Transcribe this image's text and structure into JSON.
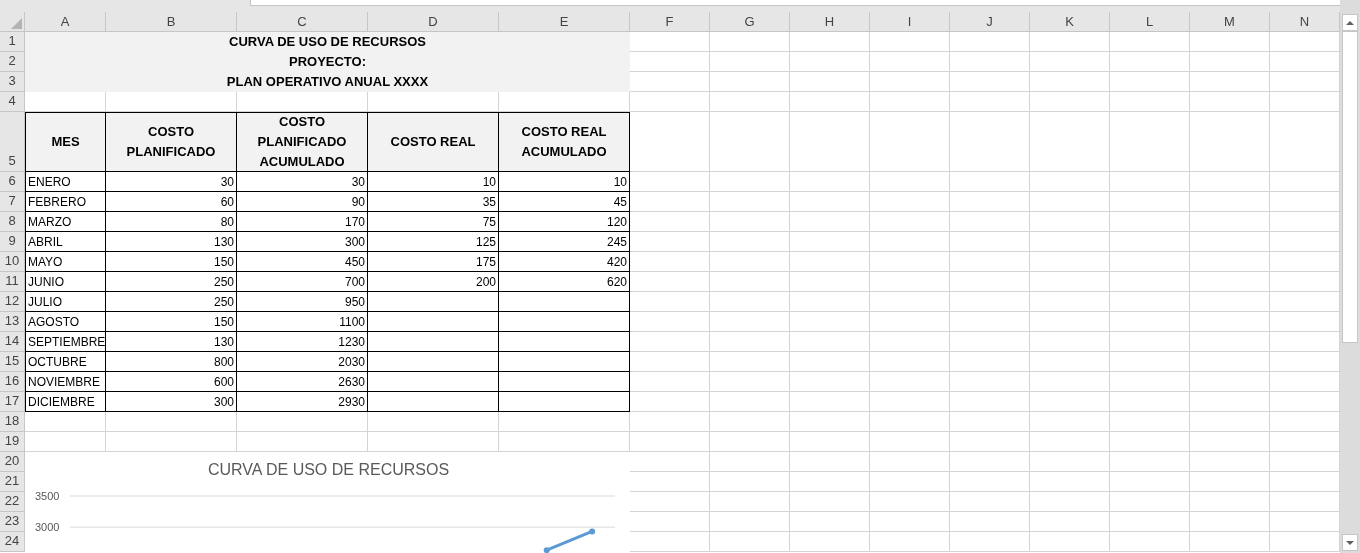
{
  "column_headers": [
    "A",
    "B",
    "C",
    "D",
    "E",
    "F",
    "G",
    "H",
    "I",
    "J",
    "K",
    "L",
    "M",
    "N"
  ],
  "row_numbers": [
    "1",
    "2",
    "3",
    "4",
    "5",
    "6",
    "7",
    "8",
    "9",
    "10",
    "11",
    "12",
    "13",
    "14",
    "15",
    "16",
    "17",
    "18",
    "19",
    "20",
    "21",
    "22",
    "23",
    "24"
  ],
  "title_lines": [
    "CURVA DE USO DE RECURSOS",
    "PROYECTO:",
    "PLAN OPERATIVO ANUAL XXXX"
  ],
  "table": {
    "columns": [
      "MES",
      "COSTO PLANIFICADO",
      "COSTO PLANIFICADO ACUMULADO",
      "COSTO REAL",
      "COSTO REAL ACUMULADO"
    ],
    "rows": [
      [
        "ENERO",
        "30",
        "30",
        "10",
        "10"
      ],
      [
        "FEBRERO",
        "60",
        "90",
        "35",
        "45"
      ],
      [
        "MARZO",
        "80",
        "170",
        "75",
        "120"
      ],
      [
        "ABRIL",
        "130",
        "300",
        "125",
        "245"
      ],
      [
        "MAYO",
        "150",
        "450",
        "175",
        "420"
      ],
      [
        "JUNIO",
        "250",
        "700",
        "200",
        "620"
      ],
      [
        "JULIO",
        "250",
        "950"
      ],
      [
        "AGOSTO",
        "150",
        "1100"
      ],
      [
        "SEPTIEMBRE",
        "130",
        "1230"
      ],
      [
        "OCTUBRE",
        "800",
        "2030"
      ],
      [
        "NOVIEMBRE",
        "600",
        "2630"
      ],
      [
        "DICIEMBRE",
        "300",
        "2930"
      ]
    ]
  },
  "chart": {
    "chart_data": {
      "type": "line",
      "title": "CURVA DE USO DE RECURSOS",
      "yticks": [
        3000,
        3500
      ],
      "ylim": [
        2600,
        3500
      ],
      "series": [
        {
          "color": "#5b9bd5",
          "marker": "circle",
          "values": [
            null,
            null,
            null,
            null,
            null,
            null,
            null,
            null,
            null,
            null,
            2630,
            2930
          ]
        }
      ]
    }
  }
}
